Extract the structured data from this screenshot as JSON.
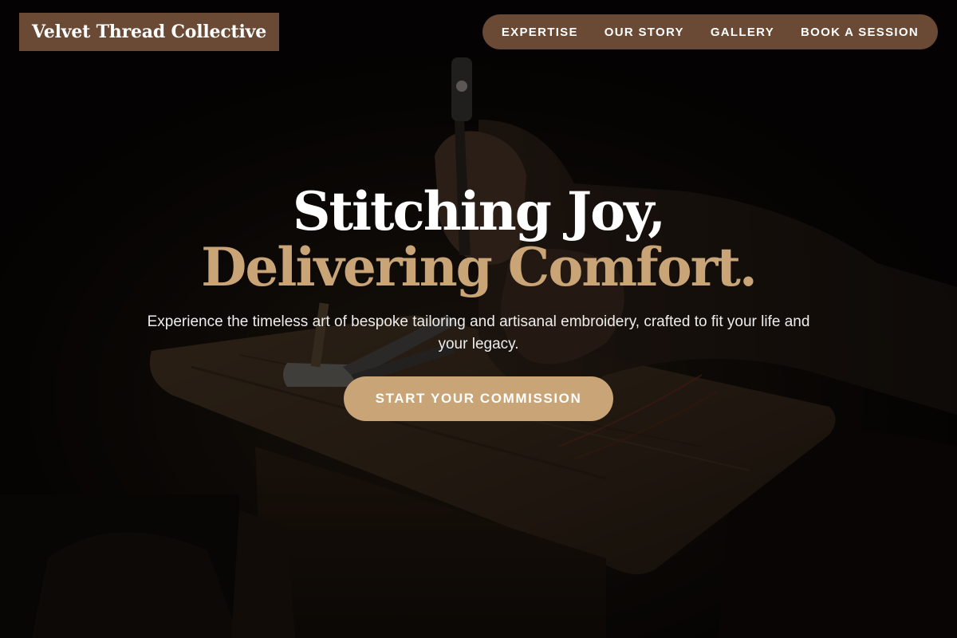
{
  "header": {
    "brand": "Velvet Thread Collective",
    "nav": [
      "EXPERTISE",
      "OUR STORY",
      "GALLERY",
      "BOOK A SESSION"
    ]
  },
  "hero": {
    "title_line1": "Stitching Joy,",
    "title_line2": "Delivering Comfort.",
    "subtitle": "Experience the timeless art of bespoke tailoring and artisanal embroidery, crafted to fit your life and your legacy.",
    "cta_label": "START YOUR COMMISSION",
    "background_image": "craftsman hands with hammer and leather tools on a worn wooden bench"
  },
  "colors": {
    "brand_brown": "#6b4a35",
    "accent_gold": "#c9a477",
    "background": "#0b0907",
    "text_white": "#ffffff"
  }
}
